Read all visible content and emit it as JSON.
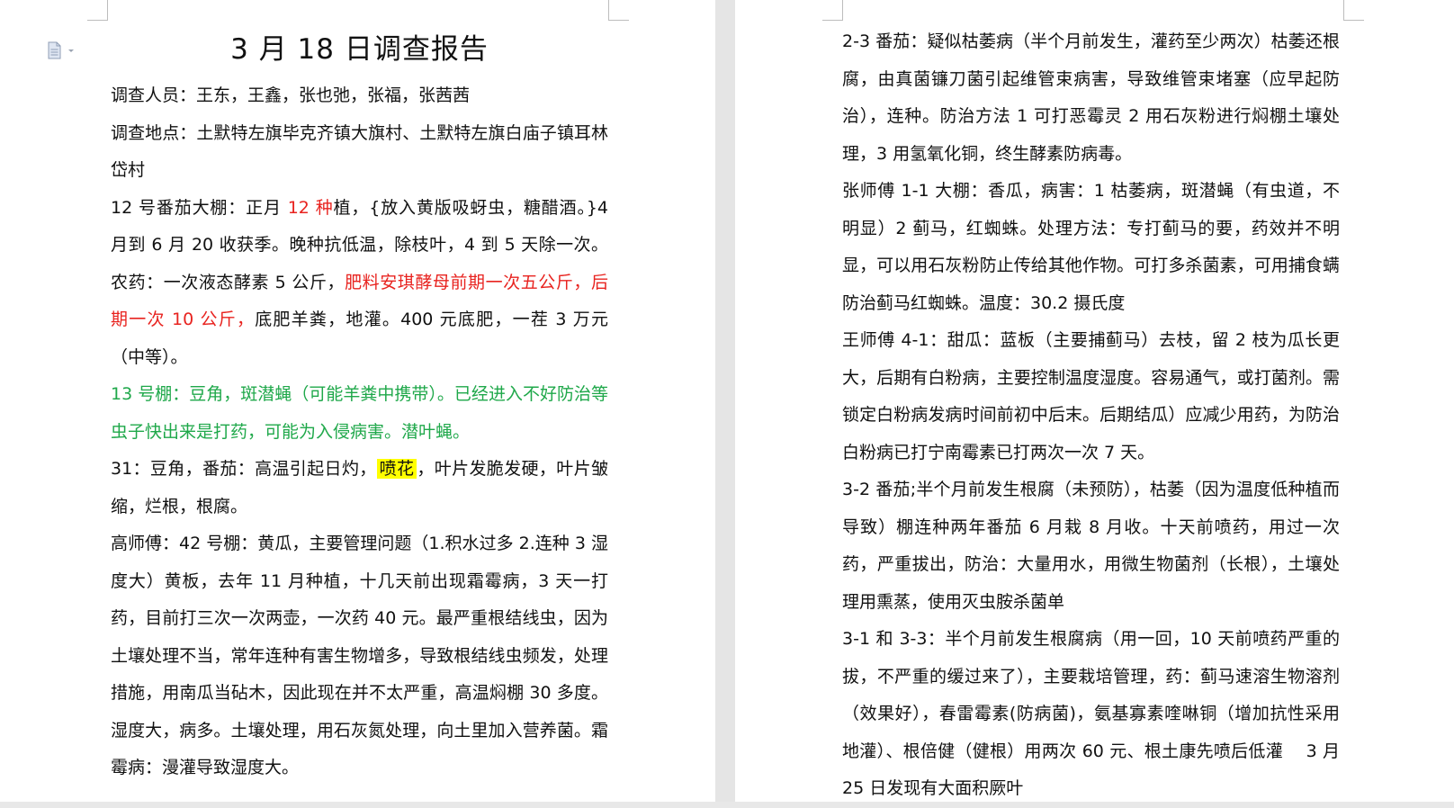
{
  "page1": {
    "title": "3 月 18 日调查报告",
    "paragraphs": [
      {
        "id": "investigators",
        "segments": [
          {
            "text": "调查人员：王东，王鑫，张也弛，张福，张茜茜",
            "style": "normal"
          }
        ]
      },
      {
        "id": "location",
        "segments": [
          {
            "text": "调查地点：土默特左旗毕克齐镇大旗村、土默特左旗白庙子镇耳林岱村",
            "style": "normal"
          }
        ]
      },
      {
        "id": "shed-12",
        "segments": [
          {
            "text": "12 号番茄大棚：正月 ",
            "style": "normal"
          },
          {
            "text": "12 种",
            "style": "red"
          },
          {
            "text": "植，{放入黄版吸蚜虫，糖醋酒。}4 月到 6 月 20 收获季。晚种抗低温，除枝叶，4 到 5 天除一次。农药：一次液态酵素 5 公斤，",
            "style": "normal"
          },
          {
            "text": "肥料安琪酵母前期一次五公斤，后期一次 10 公斤，",
            "style": "red"
          },
          {
            "text": "底肥羊粪，地灌。400 元底肥，一茬 3 万元（中等）。",
            "style": "normal"
          }
        ]
      },
      {
        "id": "shed-13",
        "segments": [
          {
            "text": "13 号棚：豆角，斑潜蝇（可能羊粪中携带）。已经进入不好防治等虫子快出来是打药，可能为入侵病害。潜叶蝇。",
            "style": "green"
          }
        ]
      },
      {
        "id": "shed-31",
        "segments": [
          {
            "text": "31：豆角，番茄：高温引起日灼，",
            "style": "normal"
          },
          {
            "text": "喷花",
            "style": "highlight"
          },
          {
            "text": "，叶片发脆发硬，叶片皱缩，烂根，根腐。",
            "style": "normal"
          }
        ]
      },
      {
        "id": "master-gao",
        "segments": [
          {
            "text": "高师傅：42 号棚：黄瓜，主要管理问题（1.积水过多 2.连种 3 湿度大）黄板，去年 11 月种植，十几天前出现霜霉病，3 天一打药，目前打三次一次两壶，一次药 40 元。最严重根结线虫，因为土壤处理不当，常年连种有害生物增多，导致根结线虫频发，处理措施，用南瓜当砧木，因此现在并不太严重，高温焖棚 30 多度。湿度大，病多。土壤处理，用石灰氮处理，向土里加入营养菌。霜霉病：漫灌导致湿度大。",
            "style": "normal"
          }
        ]
      }
    ]
  },
  "page2": {
    "paragraphs": [
      {
        "id": "tomato-2-3",
        "segments": [
          {
            "text": "2-3 番茄：疑似枯萎病（半个月前发生，灌药至少两次）枯萎还根腐，由真菌镰刀菌引起维管束病害，导致维管束堵塞（应早起防治），连种。防治方法 1 可打恶霉灵 2 用石灰粉进行焖棚土壤处理，3 用氢氧化铜，终生酵素防病毒。",
            "style": "normal"
          }
        ]
      },
      {
        "id": "master-zhang",
        "segments": [
          {
            "text": "张师傅 1-1 大棚：香瓜，病害：1 枯萎病，斑潜蝇（有虫道，不明显）2 蓟马，红蜘蛛。处理方法：专打蓟马的要，药效并不明显，可以用石灰粉防止传给其他作物。可打多杀菌素，可用捕食螨防治蓟马红蜘蛛。温度：30.2 摄氏度",
            "style": "normal"
          }
        ]
      },
      {
        "id": "master-wang",
        "segments": [
          {
            "text": "王师傅 4-1：甜瓜：蓝板（主要捕蓟马）去枝，留 2 枝为瓜长更大，后期有白粉病，主要控制温度湿度。容易通气，或打菌剂。需锁定白粉病发病时间前初中后末。后期结瓜）应减少用药，为防治白粉病已打宁南霉素已打两次一次 7 天。",
            "style": "normal"
          }
        ]
      },
      {
        "id": "tomato-3-2",
        "segments": [
          {
            "text": "3-2 番茄;半个月前发生根腐（未预防），枯萎（因为温度低种植而导致）棚连种两年番茄 6 月栽 8 月收。十天前喷药，用过一次药，严重拔出，防治：大量用水，用微生物菌剂（长根），土壤处理用熏蒸，使用灭虫胺杀菌单",
            "style": "normal"
          }
        ]
      },
      {
        "id": "shed-3-1",
        "segments": [
          {
            "text": "3-1 和 3-3：半个月前发生根腐病（用一回，10 天前喷药严重的拔，不严重的缓过来了），主要栽培管理，药：蓟马速溶生物溶剂（效果好），春雷霉素(防病菌)，氨基寡素喹啉铜（增加抗性采用地灌）、根倍健（健根）用两次 60 元、根土康先喷后低灌　 3 月 25 日发现有大面积厥叶",
            "style": "normal"
          }
        ]
      }
    ]
  },
  "icons": {
    "doc_icon": "document-dropdown-icon"
  },
  "colors": {
    "red": "#e8231f",
    "green": "#1fa84a",
    "highlight": "#ffff00"
  }
}
